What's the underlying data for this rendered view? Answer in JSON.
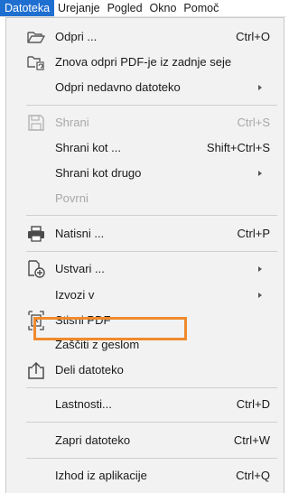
{
  "menubar": {
    "items": [
      "Datoteka",
      "Urejanje",
      "Pogled",
      "Okno",
      "Pomoč"
    ],
    "active_index": 0
  },
  "menu": {
    "items": [
      {
        "label": "Odpri ...",
        "shortcut": "Ctrl+O",
        "icon": "folder-open-icon"
      },
      {
        "label": "Znova odpri PDF-je iz zadnje seje",
        "shortcut": "",
        "icon": "reopen-session-icon"
      },
      {
        "label": "Odpri nedavno datoteko",
        "shortcut": "",
        "submenu": true
      },
      {
        "label": "Shrani",
        "shortcut": "Ctrl+S",
        "icon": "save-icon",
        "disabled": true
      },
      {
        "label": "Shrani kot ...",
        "shortcut": "Shift+Ctrl+S"
      },
      {
        "label": "Shrani kot drugo",
        "shortcut": "",
        "submenu": true
      },
      {
        "label": "Povrni",
        "shortcut": "",
        "disabled": true
      },
      {
        "label": "Natisni ...",
        "shortcut": "Ctrl+P",
        "icon": "printer-icon"
      },
      {
        "label": "Ustvari ...",
        "shortcut": "",
        "icon": "create-pdf-icon",
        "submenu": true
      },
      {
        "label": "Izvozi v",
        "shortcut": "",
        "submenu": true
      },
      {
        "label": "Stisni PDF",
        "shortcut": "",
        "icon": "compress-pdf-icon"
      },
      {
        "label": "Zaščiti z geslom",
        "shortcut": "",
        "highlighted": true
      },
      {
        "label": "Deli datoteko",
        "shortcut": "",
        "icon": "share-icon"
      },
      {
        "label": "Lastnosti...",
        "shortcut": "Ctrl+D"
      },
      {
        "label": "Zapri datoteko",
        "shortcut": "Ctrl+W"
      },
      {
        "label": "Izhod iz aplikacije",
        "shortcut": "Ctrl+Q"
      }
    ]
  },
  "colors": {
    "active_menubar": "#1f6fd1",
    "highlight_border": "#ef8a2d",
    "menu_background": "#f2f2f2",
    "disabled_text": "#a8a8a8"
  }
}
